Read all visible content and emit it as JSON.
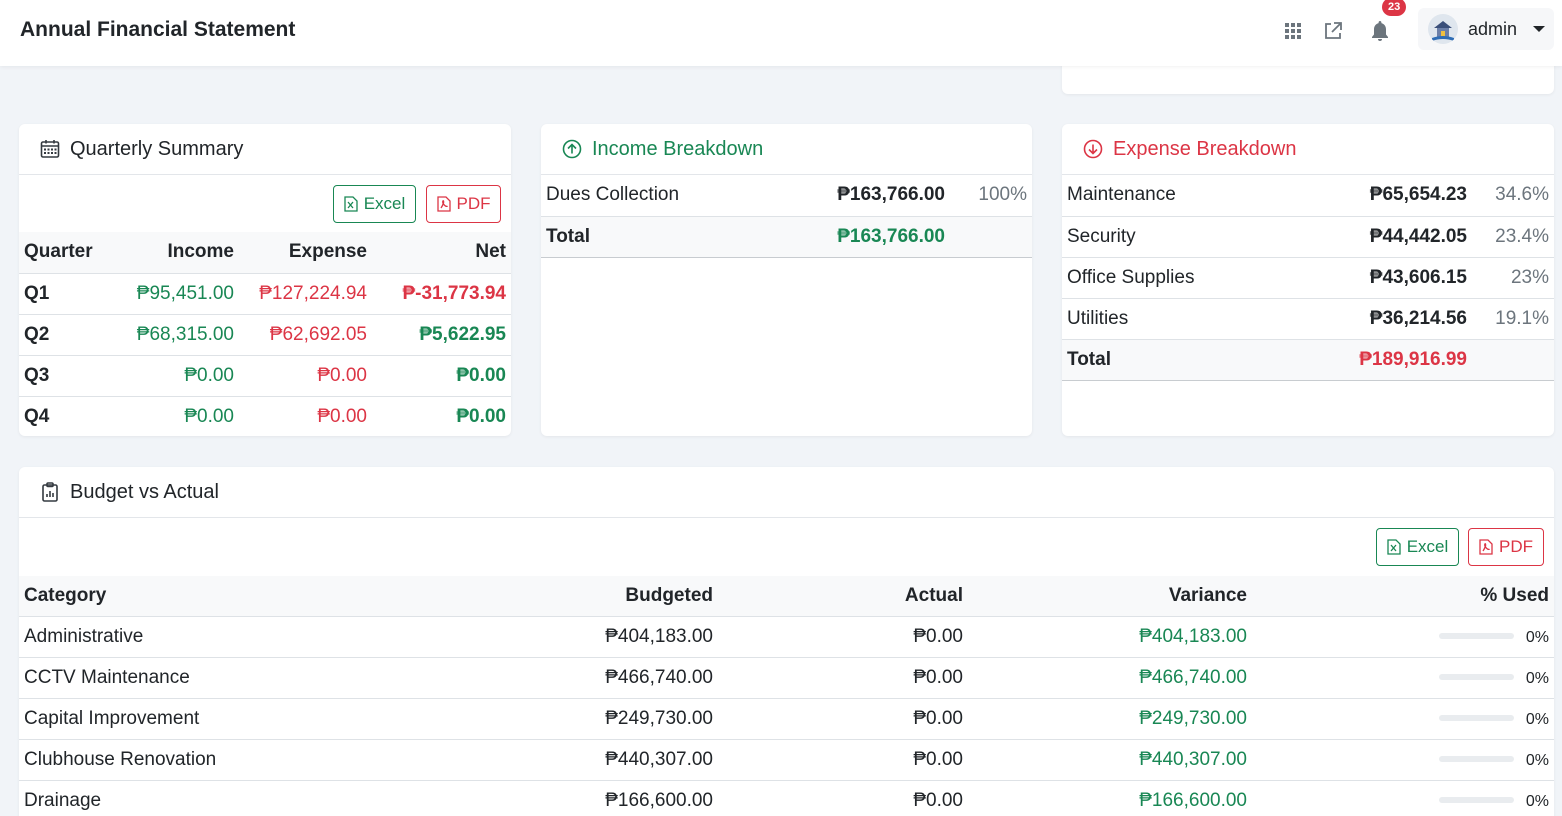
{
  "header": {
    "title": "Annual Financial Statement",
    "notification_count": "23",
    "user_name": "admin"
  },
  "quarterly": {
    "title": "Quarterly Summary",
    "excel_label": "Excel",
    "pdf_label": "PDF",
    "columns": [
      "Quarter",
      "Income",
      "Expense",
      "Net"
    ],
    "rows": [
      {
        "quarter": "Q1",
        "income": "₱95,451.00",
        "expense": "₱127,224.94",
        "net": "₱-31,773.94",
        "net_negative": true
      },
      {
        "quarter": "Q2",
        "income": "₱68,315.00",
        "expense": "₱62,692.05",
        "net": "₱5,622.95",
        "net_negative": false
      },
      {
        "quarter": "Q3",
        "income": "₱0.00",
        "expense": "₱0.00",
        "net": "₱0.00",
        "net_negative": false
      },
      {
        "quarter": "Q4",
        "income": "₱0.00",
        "expense": "₱0.00",
        "net": "₱0.00",
        "net_negative": false
      }
    ]
  },
  "income": {
    "title": "Income Breakdown",
    "rows": [
      {
        "label": "Dues Collection",
        "amount": "₱163,766.00",
        "pct": "100%"
      }
    ],
    "total_label": "Total",
    "total_amount": "₱163,766.00"
  },
  "expense": {
    "title": "Expense Breakdown",
    "rows": [
      {
        "label": "Maintenance",
        "amount": "₱65,654.23",
        "pct": "34.6%"
      },
      {
        "label": "Security",
        "amount": "₱44,442.05",
        "pct": "23.4%"
      },
      {
        "label": "Office Supplies",
        "amount": "₱43,606.15",
        "pct": "23%"
      },
      {
        "label": "Utilities",
        "amount": "₱36,214.56",
        "pct": "19.1%"
      }
    ],
    "total_label": "Total",
    "total_amount": "₱189,916.99"
  },
  "budget": {
    "title": "Budget vs Actual",
    "excel_label": "Excel",
    "pdf_label": "PDF",
    "columns": [
      "Category",
      "Budgeted",
      "Actual",
      "Variance",
      "% Used"
    ],
    "rows": [
      {
        "category": "Administrative",
        "budgeted": "₱404,183.00",
        "actual": "₱0.00",
        "variance": "₱404,183.00",
        "used": "0%",
        "used_fraction": 0
      },
      {
        "category": "CCTV Maintenance",
        "budgeted": "₱466,740.00",
        "actual": "₱0.00",
        "variance": "₱466,740.00",
        "used": "0%",
        "used_fraction": 0
      },
      {
        "category": "Capital Improvement",
        "budgeted": "₱249,730.00",
        "actual": "₱0.00",
        "variance": "₱249,730.00",
        "used": "0%",
        "used_fraction": 0
      },
      {
        "category": "Clubhouse Renovation",
        "budgeted": "₱440,307.00",
        "actual": "₱0.00",
        "variance": "₱440,307.00",
        "used": "0%",
        "used_fraction": 0
      },
      {
        "category": "Drainage",
        "budgeted": "₱166,600.00",
        "actual": "₱0.00",
        "variance": "₱166,600.00",
        "used": "0%",
        "used_fraction": 0
      }
    ]
  },
  "colors": {
    "income": "#198754",
    "expense": "#dc3545",
    "badge": "#dc3545"
  }
}
